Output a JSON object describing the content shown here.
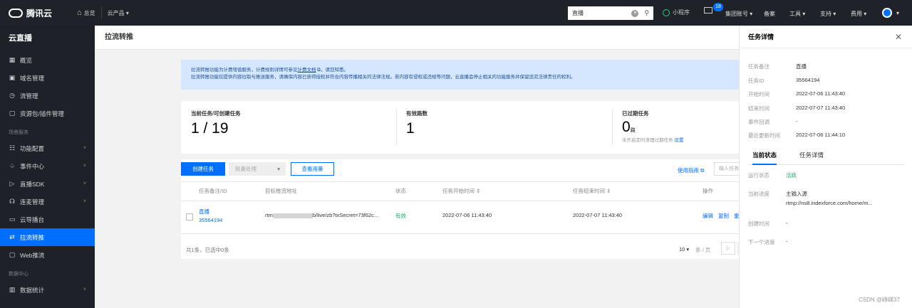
{
  "topbar": {
    "brand": "腾讯云",
    "home": "总览",
    "products": "云产品 ▾",
    "search_value": "直播",
    "miniprogram": "小程序",
    "mail_badge": "18",
    "nav": [
      "集团账号 ▾",
      "备案",
      "工具 ▾",
      "支持 ▾",
      "费用 ▾"
    ],
    "avatar_caret": "▾"
  },
  "sidebar": {
    "title": "云直播",
    "items": [
      {
        "label": "概览",
        "icon": "▦"
      },
      {
        "label": "域名管理",
        "icon": "▣"
      },
      {
        "label": "流管理",
        "icon": "◷"
      }
    ],
    "item_plugin": {
      "label": "资源包/插件管理",
      "icon": "▢"
    },
    "section1": "场景服务",
    "scene_items": [
      {
        "label": "功能配置",
        "icon": "☷",
        "chevron": "˅"
      },
      {
        "label": "事件中心",
        "icon": "♤",
        "chevron": "˅"
      },
      {
        "label": "直播SDK",
        "icon": "▷",
        "chevron": "˅"
      },
      {
        "label": "连麦管理",
        "icon": "☊",
        "chevron": "˅"
      },
      {
        "label": "云导播台",
        "icon": "▭"
      },
      {
        "label": "拉流转推",
        "icon": "⇄"
      },
      {
        "label": "Web推流",
        "icon": "▢"
      }
    ],
    "section2": "数据中心",
    "data_item": {
      "label": "数据统计",
      "icon": "▥",
      "chevron": "˅"
    }
  },
  "main": {
    "title": "拉流转推",
    "notice_line1_a": "拉流转推功能为计费增值服务，计费规则详情可参见",
    "notice_link": "计费文档",
    "notice_line1_b": "，请您知悉。",
    "notice_line2": "拉流转推功能仅提供内容拉取与推送服务，请确保内容已获得授权并符合内容传播相关的法律法规。若内容有侵权或违规等问题，云直播会停止相关的功能服务并保留追究法律责任的权利。",
    "stats": {
      "current_label": "当前任务/可创建任务",
      "current_value": "1 / 19",
      "valid_label": "有效路数",
      "valid_value": "1",
      "expired_label": "已过期任务",
      "expired_value": "0",
      "expired_unit": "路",
      "expired_sub": "未开启定时清理过期任务",
      "expired_link": "设置"
    },
    "toolbar": {
      "create": "创建任务",
      "batch": "批量处理",
      "usage": "查看用量",
      "guide": "使用指南",
      "search_placeholder": "输入任务"
    },
    "table": {
      "headers": [
        "任务备注/ID",
        "目标推流地址",
        "状态",
        "任务开始时间 ⇕",
        "任务结束时间 ⇕",
        "操作"
      ],
      "row": {
        "note": "直播",
        "id": "35564194",
        "url_a": "rtm",
        "url_b": "b/live/zb?txSecret=73f62c...",
        "status": "有效",
        "start": "2022-07-06 11:43:40",
        "end": "2022-07-07 11:43:40",
        "op_edit": "编辑",
        "op_copy": "复制",
        "op_more": "重"
      },
      "footer_left": "共1条，已选中0条",
      "page_size": "10 ▾",
      "per_page": "条 / 页",
      "first_page": "|‹"
    }
  },
  "panel": {
    "title": "任务详情",
    "close": "✕",
    "fields": [
      {
        "k": "任务备注",
        "v": "直播"
      },
      {
        "k": "任务ID",
        "v": "35564194"
      },
      {
        "k": "开始时间",
        "v": "2022-07-06 11:43:40"
      },
      {
        "k": "结束时间",
        "v": "2022-07-07 11:43:40"
      },
      {
        "k": "事件回调",
        "v": "-"
      },
      {
        "k": "最近更新时间",
        "v": "2022-07-06 11:44:10"
      }
    ],
    "tab_current": "当前状态",
    "tab_detail": "任务详情",
    "run_label": "运行状态",
    "run_value": "活跃",
    "progress_label": "当前进度",
    "progress_value": "主输入源",
    "progress_url": "rtmp://ns8.indexforce.com/home/m...",
    "create_label": "创建时间",
    "create_value": "-",
    "next_label": "下一个进度",
    "next_value": "-"
  },
  "watermark": "CSDN @峥嵘37"
}
